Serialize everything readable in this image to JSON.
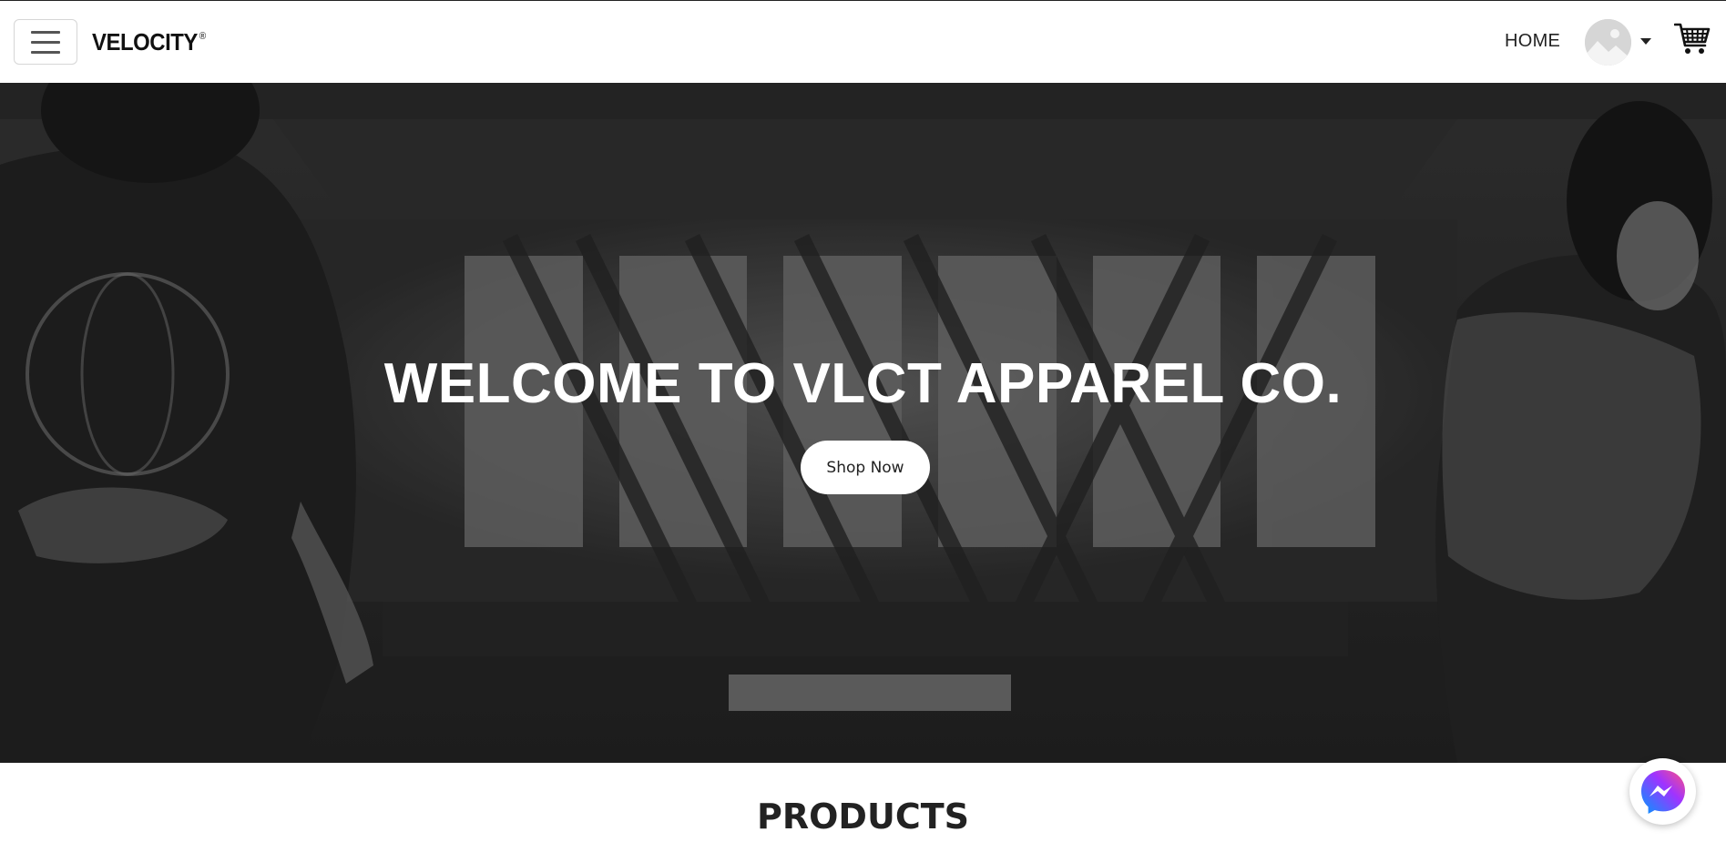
{
  "navbar": {
    "brand": "VELOCITY",
    "brand_mark": "®",
    "home_label": "HOME",
    "menu_icon": "hamburger-icon",
    "avatar_icon": "user-avatar-placeholder",
    "dropdown_icon": "caret-down-icon",
    "cart_icon": "shopping-cart-icon"
  },
  "hero": {
    "title": "WELCOME TO VLCT APPAREL CO.",
    "cta_label": "Shop Now",
    "overlay_color": "#3c3c3c"
  },
  "products": {
    "title": "PRODUCTS"
  },
  "chat": {
    "icon": "messenger-icon",
    "gradient": [
      "#0099ff",
      "#a033ff",
      "#ff5280"
    ]
  }
}
